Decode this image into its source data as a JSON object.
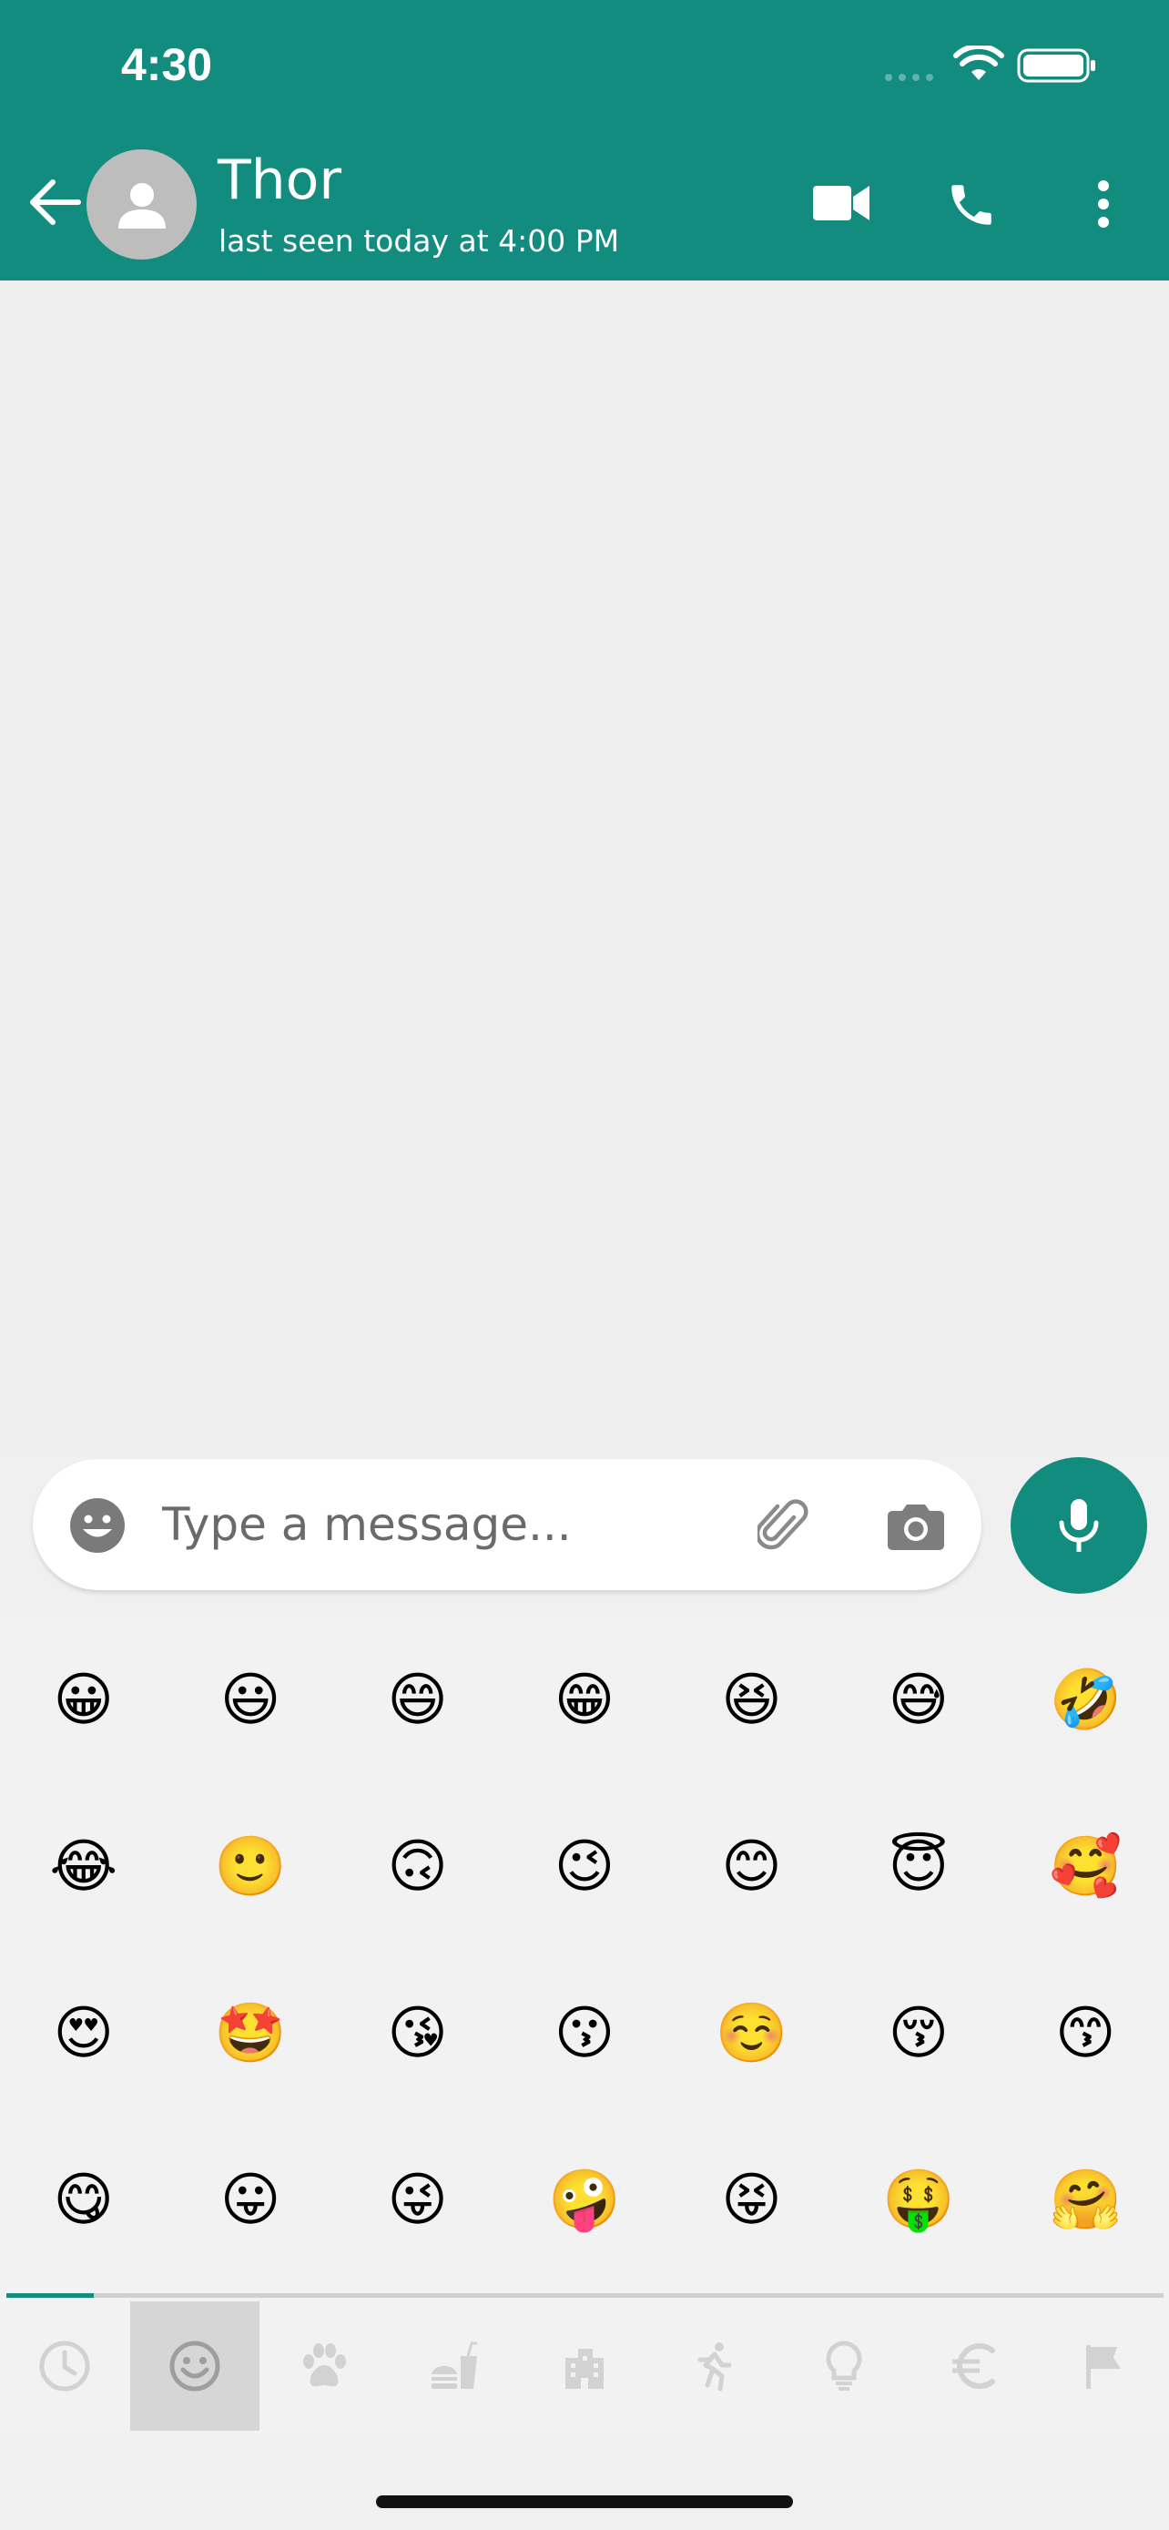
{
  "status_bar": {
    "time": "4:30"
  },
  "header": {
    "contact_name": "Thor",
    "last_seen": "last seen today at 4:00 PM",
    "icons": [
      "back-arrow-icon",
      "avatar-person-icon",
      "video-call-icon",
      "phone-icon",
      "more-vert-icon"
    ]
  },
  "composer": {
    "placeholder": "Type a message...",
    "value": "",
    "icons": [
      "emoji-icon",
      "attach-icon",
      "camera-icon",
      "mic-icon"
    ]
  },
  "emoji_keyboard": {
    "rows": [
      [
        "😀",
        "😃",
        "😄",
        "😁",
        "😆",
        "😅",
        "🤣"
      ],
      [
        "😂",
        "🙂",
        "🙃",
        "😉",
        "😊",
        "😇",
        "🥰"
      ],
      [
        "😍",
        "🤩",
        "😘",
        "😗",
        "☺️",
        "😚",
        "😙"
      ],
      [
        "😋",
        "😛",
        "😜",
        "🤪",
        "😝",
        "🤑",
        "🤗"
      ]
    ],
    "categories": [
      "recent-icon",
      "smileys-icon",
      "animals-icon",
      "food-icon",
      "places-icon",
      "activity-icon",
      "objects-icon",
      "symbols-icon",
      "flags-icon"
    ],
    "active_category_index": 1
  },
  "colors": {
    "brand": "#128c7e",
    "chat_background": "#efefef",
    "keyboard_background": "#f2f2f2",
    "icon_grey": "#d0d0d0"
  }
}
